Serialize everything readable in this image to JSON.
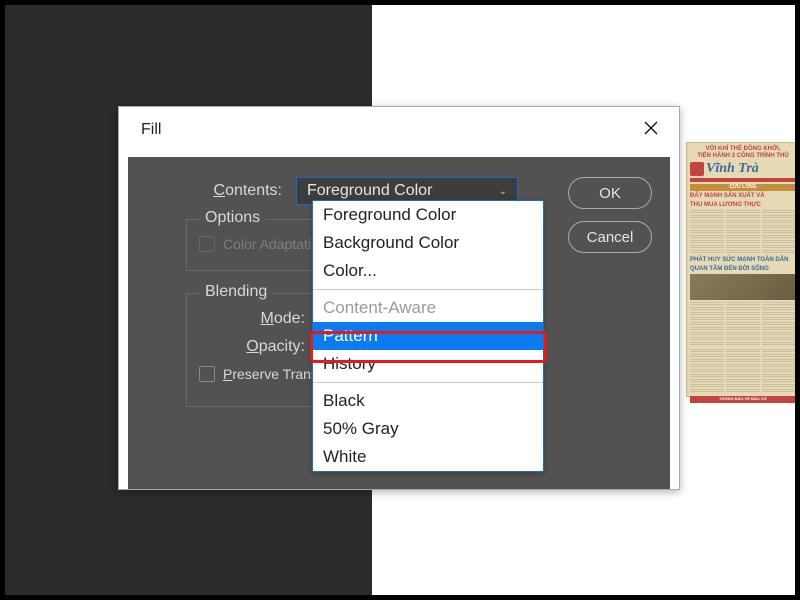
{
  "dialog": {
    "title": "Fill",
    "contents_label_pre": "C",
    "contents_label_post": "ontents:",
    "contents_value": "Foreground Color",
    "ok_label": "OK",
    "cancel_label": "Cancel",
    "options_legend": "Options",
    "color_adapt_label": "Color Adaptation",
    "blending_legend": "Blending",
    "mode_label_pre": "M",
    "mode_label_post": "ode:",
    "opacity_label_pre": "O",
    "opacity_label_post": "pacity:",
    "preserve_label_pre": "P",
    "preserve_label_post": "reserve Transparency"
  },
  "dropdown": {
    "options": [
      {
        "label": "Foreground Color",
        "state": "normal"
      },
      {
        "label": "Background Color",
        "state": "normal"
      },
      {
        "label": "Color...",
        "state": "normal"
      },
      {
        "label": "---",
        "state": "sep"
      },
      {
        "label": "Content-Aware",
        "state": "disabled"
      },
      {
        "label": "Pattern",
        "state": "highlighted"
      },
      {
        "label": "History",
        "state": "normal"
      },
      {
        "label": "---",
        "state": "sep"
      },
      {
        "label": "Black",
        "state": "normal"
      },
      {
        "label": "50% Gray",
        "state": "normal"
      },
      {
        "label": "White",
        "state": "normal"
      }
    ]
  },
  "newspaper": {
    "headline1": "VỚI KHÍ THẾ ĐỒNG KHỞI,",
    "headline2": "TIẾN HÀNH 3 CÔNG TRÌNH THỦ",
    "title": "Vĩnh Trà",
    "banner": "CỬU LONG",
    "sub1": "ĐẨY MẠNH SẢN XUẤT VÀ",
    "sub2": "THU MUA LƯƠNG THỰC",
    "sub3": "PHÁT HUY SỨC MẠNH TOÀN DÂN",
    "sub4": "QUAN TÂM ĐẾN ĐỜI SỐNG",
    "footer": "THÔNG BÁO VỀ BẦU CỬ"
  }
}
